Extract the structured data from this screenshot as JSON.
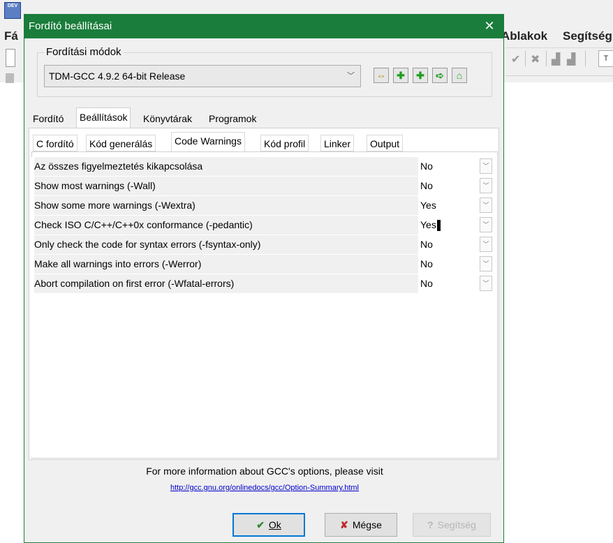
{
  "ide": {
    "menu_left": "Fá",
    "menu_windows": "Ablakok",
    "menu_help": "Segítség",
    "logo": "DEV",
    "toolbar_box": "T"
  },
  "dialog": {
    "title": "Fordító beállításai",
    "close_glyph": "✕"
  },
  "modes": {
    "legend": "Fordítási módok",
    "selected": "TDM-GCC 4.9.2 64-bit Release",
    "arrow": "﹀"
  },
  "tabs": [
    "Fordító",
    "Beállítások",
    "Könyvtárak",
    "Programok"
  ],
  "subtabs": [
    "C fordító",
    "Kód generálás",
    "Code Warnings",
    "Kód profil",
    "Linker",
    "Output"
  ],
  "options": [
    {
      "name": "Az összes figyelmeztetés kikapcsolása",
      "value": "No"
    },
    {
      "name": "Show most warnings (-Wall)",
      "value": "No"
    },
    {
      "name": "Show some more warnings (-Wextra)",
      "value": "Yes"
    },
    {
      "name": "Check ISO C/C++/C++0x conformance (-pedantic)",
      "value": "Yes"
    },
    {
      "name": "Only check the code for syntax errors (-fsyntax-only)",
      "value": "No"
    },
    {
      "name": "Make all warnings into errors (-Werror)",
      "value": "No"
    },
    {
      "name": "Abort compilation on first error (-Wfatal-errors)",
      "value": "No"
    }
  ],
  "footer": {
    "info": "For more information about GCC's options, please visit",
    "link": "http://gcc.gnu.org/onlinedocs/gcc/Option-Summary.html"
  },
  "buttons": {
    "ok": "Ok",
    "cancel": "Mégse",
    "help": "Segítség"
  }
}
